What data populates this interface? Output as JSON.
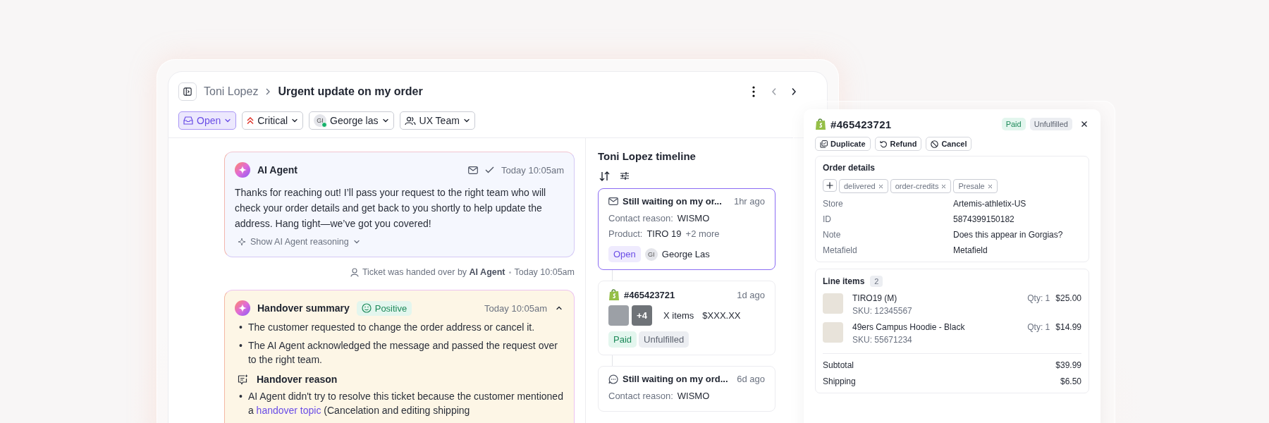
{
  "window": {
    "breadcrumb_parent": "Toni Lopez",
    "title": "Urgent update on my order"
  },
  "filters": [
    {
      "kind": "status",
      "label": "Open"
    },
    {
      "kind": "priority",
      "label": "Critical"
    },
    {
      "kind": "assignee",
      "label": "George las",
      "initials": "GI",
      "online": true
    },
    {
      "kind": "team",
      "label": "UX Team"
    }
  ],
  "messages": [
    {
      "kind": "ai_message",
      "author": "AI Agent",
      "time": "Today 10:05am",
      "body": "Thanks for reaching out! I’ll pass your request to the right team who will check your order details and get back to you shortly to help update the address. Hang tight—we’ve got you covered!",
      "reasoning_link": "Show AI Agent reasoning"
    },
    {
      "kind": "event",
      "text": "Ticket was handed over by **AI Agent**",
      "time": "Today 10:05am"
    },
    {
      "kind": "summary",
      "title": "Handover summary",
      "sentiment": "Positive",
      "time": "Today 10:05am",
      "expanded": true,
      "marker": "•",
      "bullets": [
        "The customer requested to change the order address or cancel it.",
        "The AI Agent acknowledged the message and passed the request over to the right team."
      ],
      "reason_title": "Handover reason",
      "reason": {
        "before": "AI Agent didn't try to resolve this ticket because the customer mentioned a ",
        "link": "handover topic",
        "after": " (Cancelation and editing shipping"
      }
    }
  ],
  "timeline": {
    "title": "Toni Lopez timeline",
    "items": [
      {
        "kind": "email_ticket",
        "title": "Still waiting on my or...",
        "time": "1hr ago",
        "selected": true,
        "rows": [
          {
            "label": "Contact reason:",
            "value": "WISMO"
          },
          {
            "label": "Product:",
            "value": "TIRO 19",
            "more": "+2 more"
          }
        ],
        "status": "Open",
        "assignee_initials": "GI",
        "assignee": "George Las"
      },
      {
        "kind": "order",
        "title": "#465423721",
        "time": "1d ago",
        "selected": false,
        "extra_count": "+4",
        "items": "X items",
        "total": "$XXX.XX",
        "tags": [
          {
            "kind": "paid",
            "label": "Paid"
          },
          {
            "kind": "unfulfilled",
            "label": "Unfulfilled"
          }
        ]
      },
      {
        "kind": "chat_ticket",
        "title": "Still waiting on my ord...",
        "time": "6d ago",
        "selected": false,
        "rows": [
          {
            "label": "Contact reason:",
            "value": "WISMO"
          }
        ]
      }
    ]
  },
  "order_panel": {
    "title": "#465423721",
    "badges": [
      {
        "kind": "paid",
        "label": "Paid"
      },
      {
        "kind": "unfulfilled",
        "label": "Unfulfilled"
      }
    ],
    "actions": [
      {
        "kind": "duplicate",
        "label": "Duplicate"
      },
      {
        "kind": "refund",
        "label": "Refund"
      },
      {
        "kind": "cancel",
        "label": "Cancel"
      }
    ],
    "details": {
      "title": "Order details",
      "tags": [
        "delivered",
        "order-credits",
        "Presale"
      ],
      "fields": [
        {
          "label": "Store",
          "value": "Artemis-athletix-US"
        },
        {
          "label": "ID",
          "value": "5874399150182"
        },
        {
          "label": "Note",
          "value": "Does this appear in Gorgias?"
        },
        {
          "label": "Metafield",
          "value": "Metafield"
        }
      ]
    },
    "line_items": {
      "title": "Line items",
      "count": "2",
      "items": [
        {
          "name": "TIRO19 (M)",
          "sku": "SKU: 12345567",
          "qty": "Qty: 1",
          "price": "$25.00"
        },
        {
          "name": "49ers Campus Hoodie - Black",
          "sku": "SKU: 55671234",
          "qty": "Qty: 1",
          "price": "$14.99"
        }
      ],
      "totals": [
        {
          "label": "Subtotal",
          "value": "$39.99"
        },
        {
          "label": "Shipping",
          "value": "$6.50"
        }
      ]
    }
  }
}
